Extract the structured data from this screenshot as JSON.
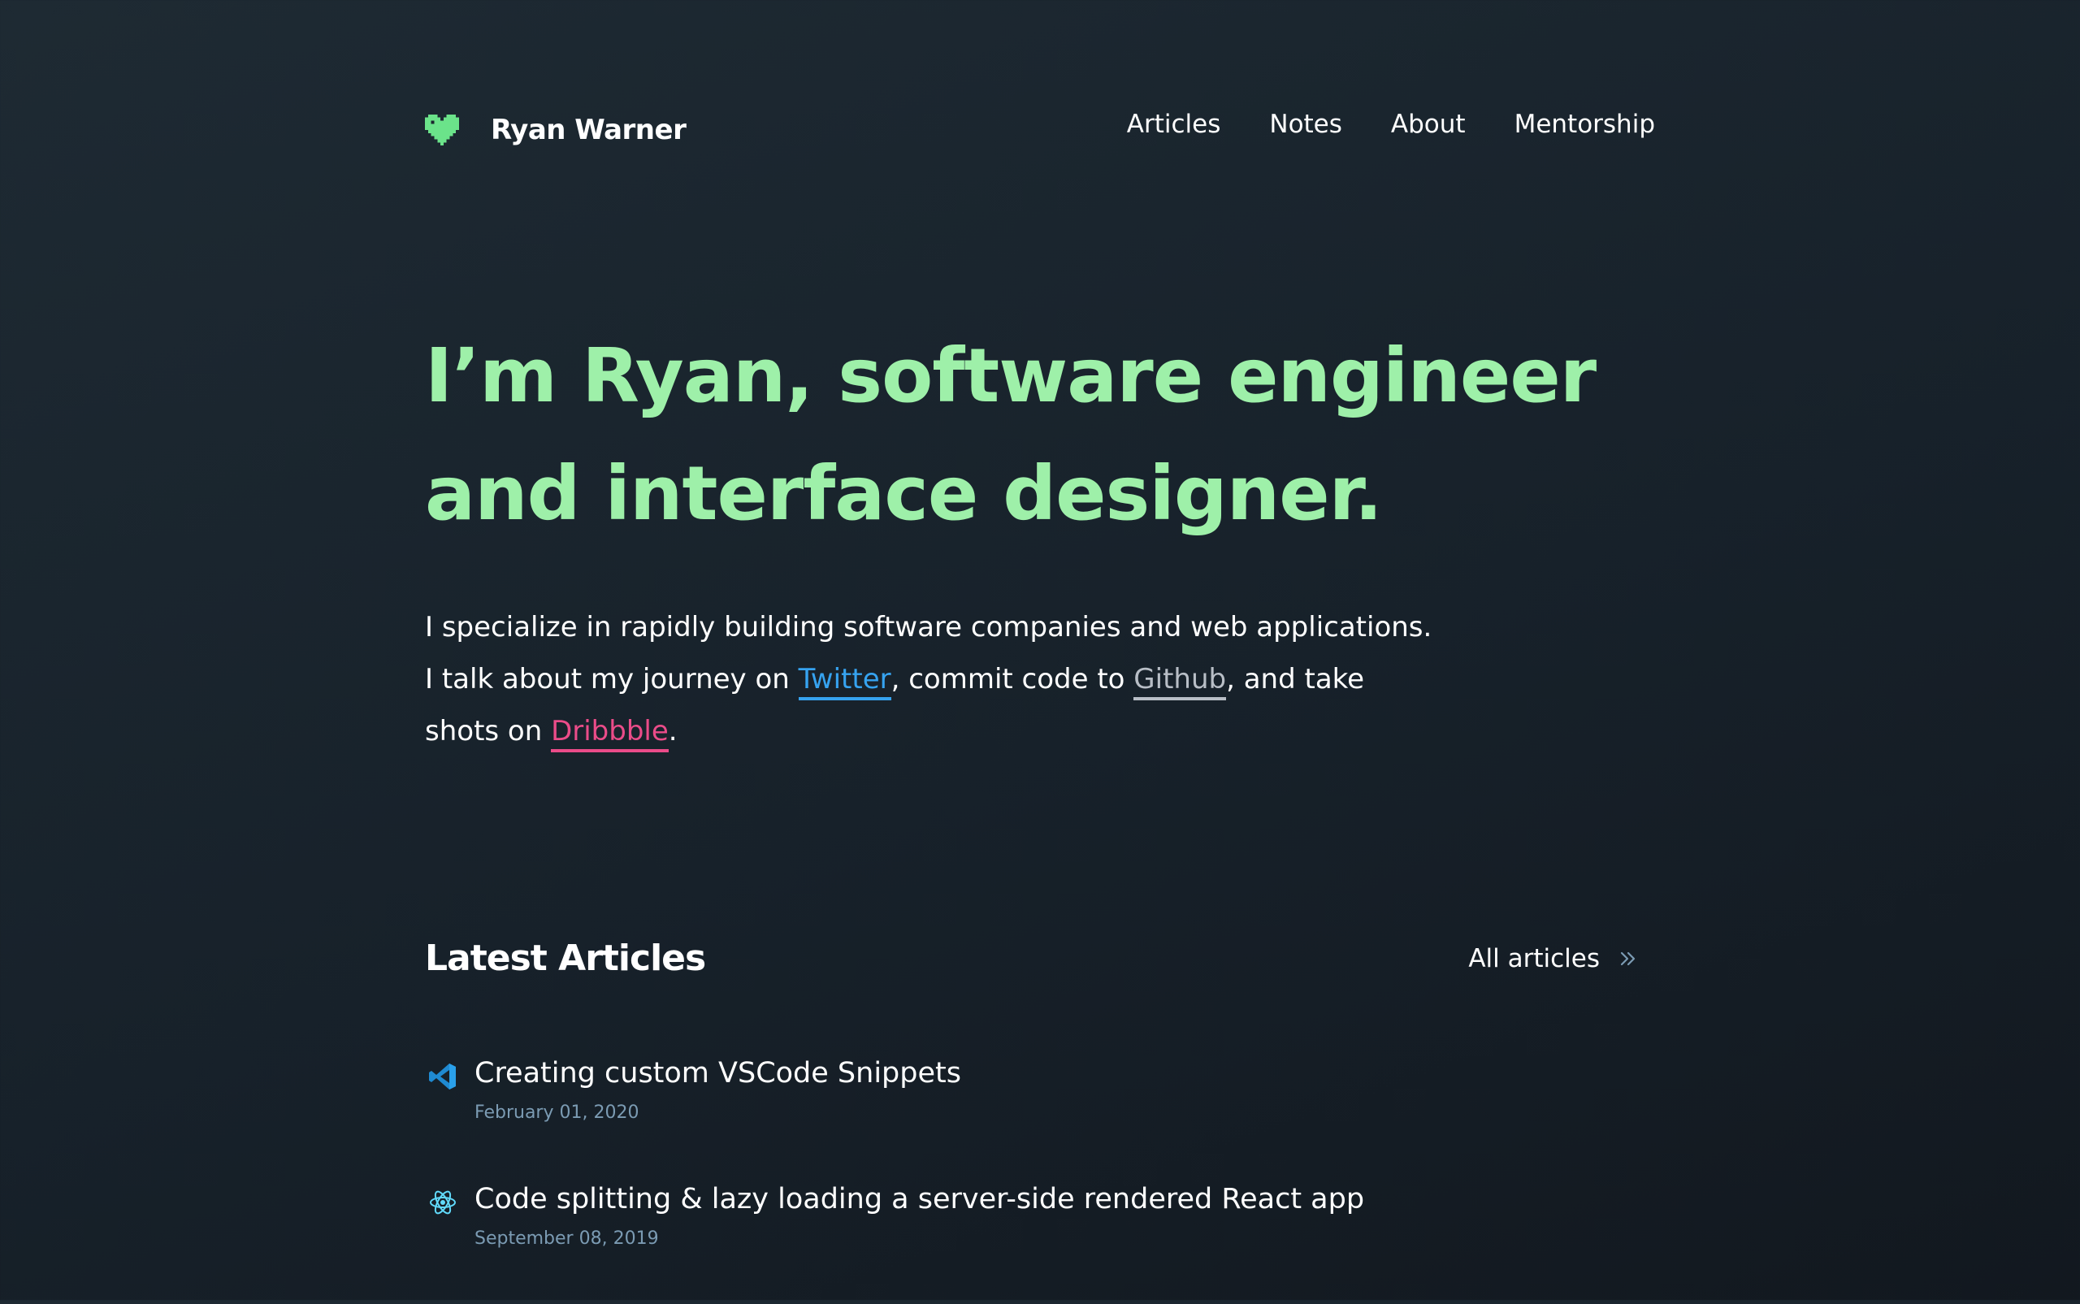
{
  "site": {
    "name": "Ryan Warner",
    "logo_icon": "pixel-heart-icon"
  },
  "nav": {
    "items": [
      {
        "label": "Articles"
      },
      {
        "label": "Notes"
      },
      {
        "label": "About"
      },
      {
        "label": "Mentorship"
      }
    ]
  },
  "hero": {
    "title_line1": "I’m Ryan, software engineer",
    "title_line2": "and interface designer.",
    "intro_before": "I specialize in rapidly building software companies and web applications. I talk about my journey on ",
    "twitter_label": "Twitter",
    "intro_mid1": ", commit code to ",
    "github_label": "Github",
    "intro_mid2": ", and take shots on ",
    "dribbble_label": "Dribbble",
    "intro_end": "."
  },
  "articles": {
    "heading": "Latest Articles",
    "all_label": "All articles",
    "all_icon": "double-chevron-right-icon",
    "items": [
      {
        "icon": "vscode-icon",
        "title": "Creating custom VSCode Snippets",
        "date": "February 01, 2020"
      },
      {
        "icon": "react-icon",
        "title": "Code splitting & lazy loading a server-side rendered React app",
        "date": "September 08, 2019"
      }
    ]
  },
  "colors": {
    "background": "#1b252e",
    "accent_green": "#9ef0a9",
    "logo_green": "#6be38a",
    "twitter_blue": "#36a3f0",
    "github_gray": "#b8bec6",
    "dribbble_pink": "#ea4c89",
    "date_color": "#7b9bb3"
  }
}
